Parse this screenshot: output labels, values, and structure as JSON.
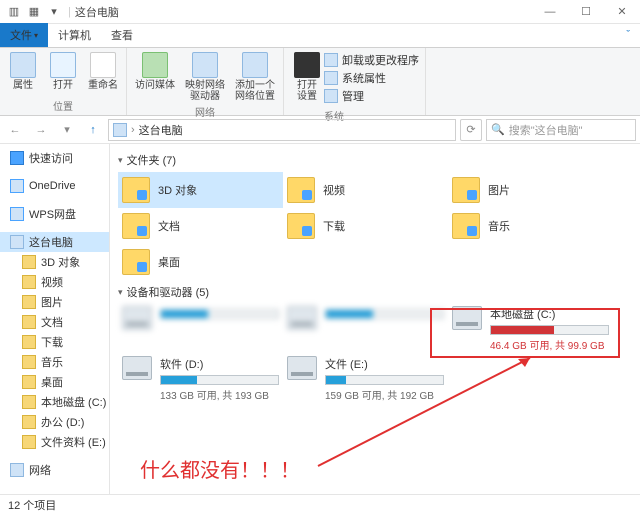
{
  "title": "这台电脑",
  "tabs": {
    "file": "文件",
    "computer": "计算机",
    "view": "查看"
  },
  "ribbon": {
    "position": {
      "props": "属性",
      "open": "打开",
      "rename": "重命名",
      "group": "位置"
    },
    "network": {
      "media": "访问媒体",
      "map": "映射网络\n驱动器",
      "addloc": "添加一个\n网络位置",
      "group": "网络"
    },
    "system": {
      "opensettings": "打开\n设置",
      "uninstall": "卸载或更改程序",
      "sysprops": "系统属性",
      "manage": "管理",
      "group": "系统"
    }
  },
  "path": {
    "root": "这台电脑"
  },
  "search": {
    "placeholder": "搜索\"这台电脑\""
  },
  "sidebar": {
    "quick": "快速访问",
    "onedrive": "OneDrive",
    "wps": "WPS网盘",
    "thispc": "这台电脑",
    "items": [
      "3D 对象",
      "视频",
      "图片",
      "文档",
      "下载",
      "音乐",
      "桌面",
      "本地磁盘 (C:)",
      "办公 (D:)",
      "文件资料 (E:)"
    ],
    "network": "网络"
  },
  "sections": {
    "folders": "文件夹 (7)",
    "drives": "设备和驱动器 (5)"
  },
  "folders": [
    "3D 对象",
    "视频",
    "图片",
    "文档",
    "下载",
    "音乐",
    "桌面"
  ],
  "drives": [
    {
      "name": "本地磁盘 (C:)",
      "sub": "46.4 GB 可用, 共 99.9 GB",
      "fill": 54,
      "red": true
    },
    {
      "name": "软件 (D:)",
      "sub": "133 GB 可用, 共 193 GB",
      "fill": 31,
      "red": false
    },
    {
      "name": "文件 (E:)",
      "sub": "159 GB 可用, 共 192 GB",
      "fill": 17,
      "red": false
    }
  ],
  "annotation": "什么都没有！！！",
  "status": "12 个项目"
}
